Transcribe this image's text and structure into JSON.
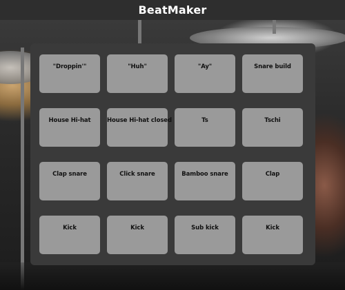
{
  "app": {
    "title": "BeatMaker"
  },
  "pads": [
    [
      "\"Droppin'\"",
      "\"Huh\"",
      "\"Ay\"",
      "Snare build"
    ],
    [
      "House Hi-hat",
      "House Hi-hat closed",
      "Ts",
      "Tschi"
    ],
    [
      "Clap snare",
      "Click snare",
      "Bamboo snare",
      "Clap"
    ],
    [
      "Kick",
      "Kick",
      "Sub kick",
      "Kick"
    ]
  ],
  "colors": {
    "header": "#2e2e2e",
    "panel": "#3a3a3a",
    "pad": "#9a9a9a",
    "pad_text": "#111111"
  }
}
